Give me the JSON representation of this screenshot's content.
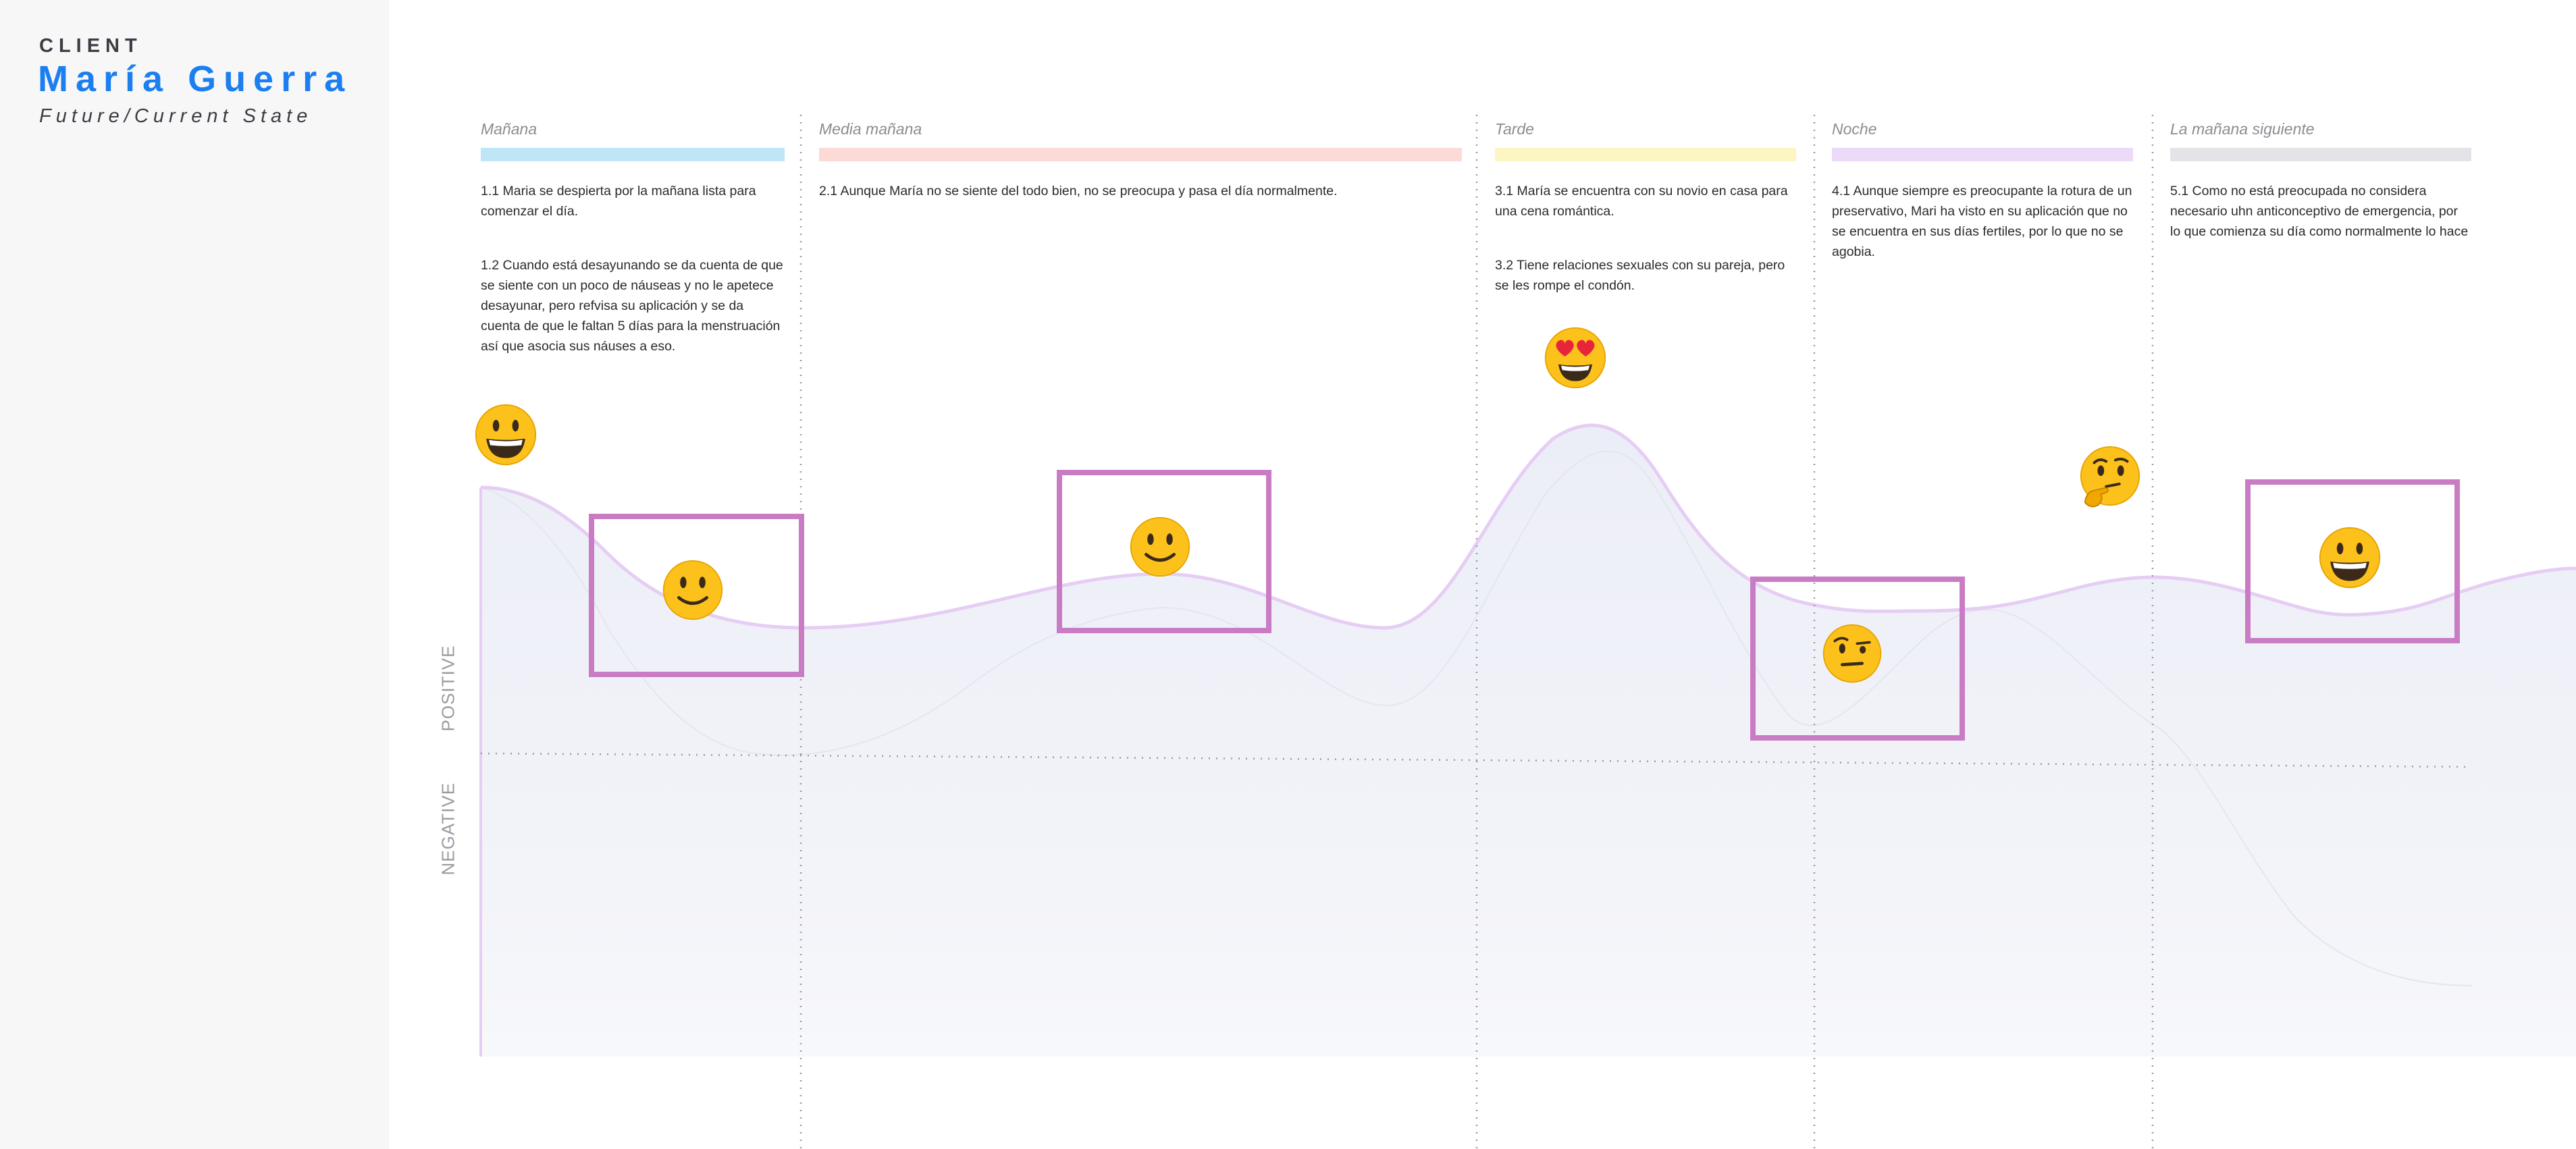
{
  "client": {
    "label": "CLIENT",
    "name": "María Guerra",
    "state": "Future/Current State"
  },
  "axis": {
    "positive": "POSITIVE",
    "negative": "NEGATIVE"
  },
  "stages": [
    {
      "title": "Mañana",
      "color": "#bfe6f7",
      "steps": [
        "1.1 Maria se despierta por la mañana lista para comenzar el día.",
        "1.2 Cuando está desayunando se da cuenta de que se siente con un poco de náuseas y no le apetece desayunar, pero refvisa su aplicación y se da cuenta de que le faltan 5 días para la menstruación así que asocia sus náuses a eso."
      ]
    },
    {
      "title": "Media mañana",
      "color": "#fcdad6",
      "steps": [
        "2.1 Aunque María no se siente del todo bien, no se preocupa y pasa el día normalmente."
      ]
    },
    {
      "title": "Tarde",
      "color": "#fdf5c2",
      "steps": [
        "3.1 María se encuentra con su novio en casa para una cena romántica.",
        "3.2 Tiene relaciones sexuales con su pareja, pero se les rompe el condón."
      ]
    },
    {
      "title": "Noche",
      "color": "#ebdaf8",
      "steps": [
        "4.1 Aunque siempre es preocupante la rotura de un preservativo, Mari ha visto en su aplicación que no se encuentra en sus días fertiles, por lo que no se agobia."
      ]
    },
    {
      "title": "La mañana siguiente",
      "color": "#e4e4e8",
      "steps": [
        "5.1 Como no está preocupada no considera necesario uhn anticonceptivo de emergencia, por lo que comienza su día como normalmente lo hace"
      ]
    }
  ],
  "emotions": [
    {
      "icon": "grinning-face-icon",
      "stage": "Mañana"
    },
    {
      "icon": "slightly-smiling-face-icon",
      "stage": "Mañana",
      "highlighted": true
    },
    {
      "icon": "slightly-smiling-face-icon",
      "stage": "Media mañana",
      "highlighted": true
    },
    {
      "icon": "heart-eyes-face-icon",
      "stage": "Tarde"
    },
    {
      "icon": "raised-eyebrow-face-icon",
      "stage": "Noche",
      "highlighted": true
    },
    {
      "icon": "thinking-face-icon",
      "stage": "Noche"
    },
    {
      "icon": "grinning-face-icon",
      "stage": "La mañana siguiente",
      "highlighted": true
    }
  ],
  "colors": {
    "brand": "#1b7ff0",
    "highlight": "#c97cc4",
    "curve": "#e6cdf4",
    "emoji_face": "#fcc21b"
  }
}
